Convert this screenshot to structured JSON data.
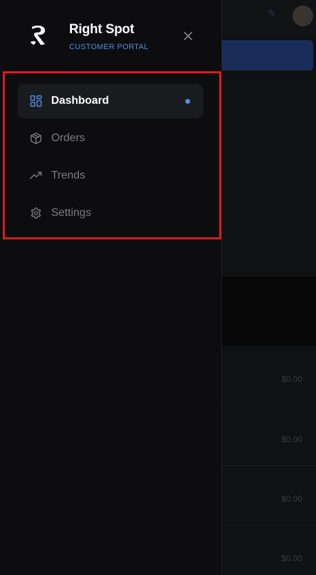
{
  "brand": {
    "name": "Right Spot",
    "subtitle": "CUSTOMER PORTAL",
    "logo_icon": "right-spot-logo"
  },
  "drawer": {
    "close_icon": "close-icon"
  },
  "nav": {
    "items": [
      {
        "label": "Dashboard",
        "icon": "dashboard-icon",
        "active": true
      },
      {
        "label": "Orders",
        "icon": "package-icon",
        "active": false
      },
      {
        "label": "Trends",
        "icon": "trending-up-icon",
        "active": false
      },
      {
        "label": "Settings",
        "icon": "gear-icon",
        "active": false
      }
    ]
  },
  "background": {
    "prices": [
      "$0.00",
      "$0.00",
      "$0.00",
      "$0.00"
    ]
  },
  "colors": {
    "accent": "#4f8fe6",
    "highlight_border": "#e01b1b",
    "drawer_bg": "#0d0d0f",
    "active_item_bg": "#1a1b1e"
  }
}
